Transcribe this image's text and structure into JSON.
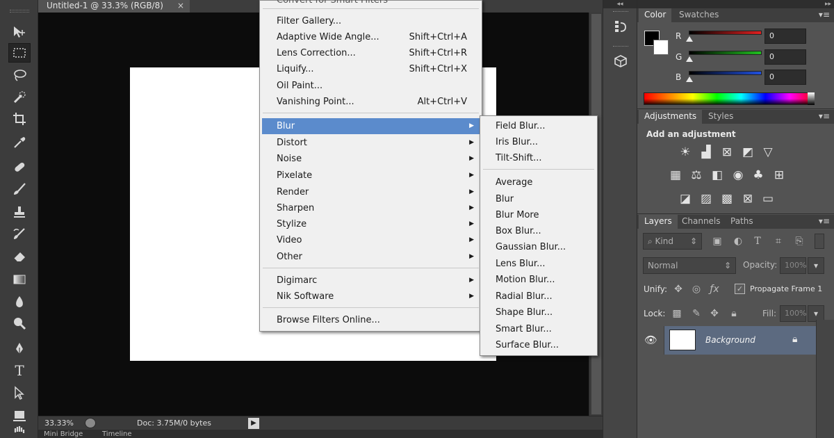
{
  "document_tab": {
    "title": "Untitled-1 @ 33.3% (RGB/8)",
    "close": "×"
  },
  "status": {
    "zoom": "33.33%",
    "doc_size": "Doc: 3.75M/0 bytes",
    "arrow": "▶"
  },
  "bottom_tabs": [
    "Mini Bridge",
    "Timeline"
  ],
  "tools": [
    "move-tool",
    "marquee-tool",
    "lasso-tool",
    "quick-selection-tool",
    "crop-tool",
    "eyedropper-tool",
    "healing-brush-tool",
    "brush-tool",
    "clone-stamp-tool",
    "history-brush-tool",
    "eraser-tool",
    "gradient-tool",
    "blur-tool",
    "dodge-tool",
    "pen-tool",
    "type-tool",
    "path-selection-tool",
    "rectangle-tool",
    "hand-tool"
  ],
  "filter_menu": {
    "top_partial": "Convert for Smart Filters",
    "group1": [
      {
        "label": "Filter Gallery...",
        "shortcut": ""
      },
      {
        "label": "Adaptive Wide Angle...",
        "shortcut": "Shift+Ctrl+A"
      },
      {
        "label": "Lens Correction...",
        "shortcut": "Shift+Ctrl+R"
      },
      {
        "label": "Liquify...",
        "shortcut": "Shift+Ctrl+X"
      },
      {
        "label": "Oil Paint...",
        "shortcut": ""
      },
      {
        "label": "Vanishing Point...",
        "shortcut": "Alt+Ctrl+V"
      }
    ],
    "group2": [
      "Blur",
      "Distort",
      "Noise",
      "Pixelate",
      "Render",
      "Sharpen",
      "Stylize",
      "Video",
      "Other"
    ],
    "group3": [
      "Digimarc",
      "Nik Software"
    ],
    "group4": [
      "Browse Filters Online..."
    ],
    "highlighted": "Blur"
  },
  "blur_submenu": {
    "group1": [
      "Field Blur...",
      "Iris Blur...",
      "Tilt-Shift..."
    ],
    "group2": [
      "Average",
      "Blur",
      "Blur More",
      "Box Blur...",
      "Gaussian Blur...",
      "Lens Blur...",
      "Motion Blur...",
      "Radial Blur...",
      "Shape Blur...",
      "Smart Blur...",
      "Surface Blur..."
    ]
  },
  "color_panel": {
    "tabs": [
      "Color",
      "Swatches"
    ],
    "channels": [
      {
        "label": "R",
        "value": "0",
        "color": "#e02020"
      },
      {
        "label": "G",
        "value": "0",
        "color": "#20c020"
      },
      {
        "label": "B",
        "value": "0",
        "color": "#2050e0"
      }
    ]
  },
  "adjustments_panel": {
    "tabs": [
      "Adjustments",
      "Styles"
    ],
    "title": "Add an adjustment"
  },
  "layers_panel": {
    "tabs": [
      "Layers",
      "Channels",
      "Paths"
    ],
    "filter_kind": "Kind",
    "blend_mode": "Normal",
    "opacity_label": "Opacity:",
    "opacity_value": "100%",
    "unify_label": "Unify:",
    "propagate_label": "Propagate Frame 1",
    "lock_label": "Lock:",
    "fill_label": "Fill:",
    "fill_value": "100%",
    "layer_name": "Background"
  },
  "mid_dock": {
    "history_icon": "history-icon",
    "properties_icon": "3d-icon"
  }
}
